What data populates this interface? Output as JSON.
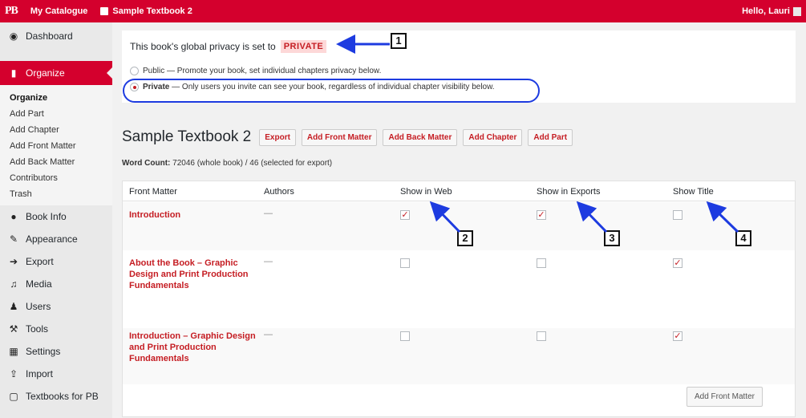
{
  "adminbar": {
    "logo": "PB",
    "my_catalogue": "My Catalogue",
    "book_name": "Sample Textbook 2",
    "greeting": "Hello, Lauri"
  },
  "sidebar": {
    "dashboard": "Dashboard",
    "organize": "Organize",
    "submenu": [
      "Organize",
      "Add Part",
      "Add Chapter",
      "Add Front Matter",
      "Add Back Matter",
      "Contributors",
      "Trash"
    ],
    "items": [
      "Book Info",
      "Appearance",
      "Export",
      "Media",
      "Users",
      "Tools",
      "Settings",
      "Import",
      "Textbooks for PB"
    ]
  },
  "privacy": {
    "prefix": "This book's global privacy is set to",
    "status": "PRIVATE",
    "public_label": "Public",
    "public_desc": " — Promote your book, set individual chapters privacy below.",
    "private_label": "Private",
    "private_desc": " — Only users you invite can see your book, regardless of individual chapter visibility below."
  },
  "title_row": {
    "title": "Sample Textbook 2",
    "buttons": [
      "Export",
      "Add Front Matter",
      "Add Back Matter",
      "Add Chapter",
      "Add Part"
    ]
  },
  "wordcount": {
    "label": "Word Count:",
    "value": " 72046 (whole book) / 46 (selected for export)"
  },
  "table": {
    "headers": [
      "Front Matter",
      "Authors",
      "Show in Web",
      "Show in Exports",
      "Show Title"
    ],
    "rows": [
      {
        "title": "Introduction",
        "authors": "—",
        "web": true,
        "exports": true,
        "show_title": false
      },
      {
        "title": "About the Book – Graphic Design and Print Production Fundamentals",
        "authors": "—",
        "web": false,
        "exports": false,
        "show_title": true
      },
      {
        "title": "Introduction – Graphic Design and Print Production Fundamentals",
        "authors": "—",
        "web": false,
        "exports": false,
        "show_title": true
      }
    ],
    "footer_button": "Add Front Matter"
  },
  "callouts": [
    "1",
    "2",
    "3",
    "4"
  ],
  "colors": {
    "brand": "#d4002d",
    "link": "#c51d23",
    "annotation": "#1d3be0"
  }
}
